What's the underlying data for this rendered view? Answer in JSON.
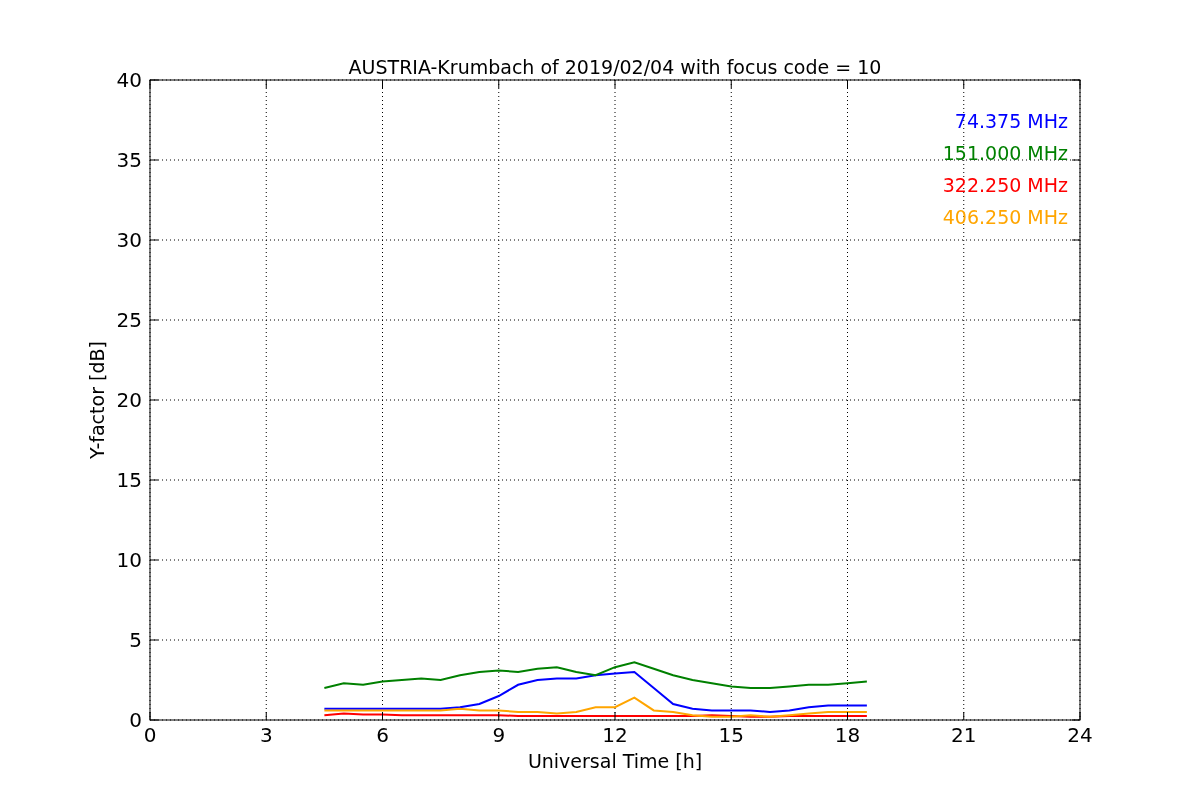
{
  "chart_data": {
    "type": "line",
    "grid": true,
    "title": "AUSTRIA-Krumbach of 2019/02/04 with focus code = 10",
    "xlabel": "Universal Time [h]",
    "ylabel": "Y-factor [dB]",
    "x": [
      4.5,
      5,
      5.5,
      6,
      6.5,
      7,
      7.5,
      8,
      8.5,
      9,
      9.5,
      10,
      10.5,
      11,
      11.5,
      12,
      12.5,
      13,
      13.5,
      14,
      14.5,
      15,
      15.5,
      16,
      16.5,
      17,
      17.5,
      18,
      18.5
    ],
    "series": [
      {
        "name": "74.375 MHz",
        "color": "#0000ff",
        "values": [
          0.7,
          0.7,
          0.7,
          0.7,
          0.7,
          0.7,
          0.7,
          0.8,
          1.0,
          1.5,
          2.2,
          2.5,
          2.6,
          2.6,
          2.8,
          2.9,
          3.0,
          2.0,
          1.0,
          0.7,
          0.6,
          0.6,
          0.6,
          0.5,
          0.6,
          0.8,
          0.9,
          0.9,
          0.9
        ]
      },
      {
        "name": "151.000 MHz",
        "color": "#008000",
        "values": [
          2.0,
          2.3,
          2.2,
          2.4,
          2.5,
          2.6,
          2.5,
          2.8,
          3.0,
          3.1,
          3.0,
          3.2,
          3.3,
          3.0,
          2.8,
          3.3,
          3.6,
          3.2,
          2.8,
          2.5,
          2.3,
          2.1,
          2.0,
          2.0,
          2.1,
          2.2,
          2.2,
          2.3,
          2.4
        ]
      },
      {
        "name": "322.250 MHz",
        "color": "#ff0000",
        "values": [
          0.3,
          0.4,
          0.35,
          0.35,
          0.3,
          0.3,
          0.3,
          0.3,
          0.3,
          0.3,
          0.25,
          0.25,
          0.25,
          0.25,
          0.25,
          0.25,
          0.25,
          0.25,
          0.25,
          0.25,
          0.3,
          0.25,
          0.2,
          0.2,
          0.25,
          0.25,
          0.25,
          0.25,
          0.25
        ]
      },
      {
        "name": "406.250 MHz",
        "color": "#ffa500",
        "values": [
          0.6,
          0.6,
          0.6,
          0.6,
          0.6,
          0.6,
          0.6,
          0.7,
          0.6,
          0.6,
          0.5,
          0.5,
          0.4,
          0.5,
          0.8,
          0.8,
          1.4,
          0.6,
          0.5,
          0.3,
          0.2,
          0.2,
          0.3,
          0.2,
          0.3,
          0.4,
          0.5,
          0.5,
          0.5
        ]
      }
    ],
    "xlim": [
      0,
      24
    ],
    "ylim": [
      0,
      40
    ],
    "xticks": [
      0,
      3,
      6,
      9,
      12,
      15,
      18,
      21,
      24
    ],
    "yticks": [
      0,
      5,
      10,
      15,
      20,
      25,
      30,
      35,
      40
    ]
  }
}
